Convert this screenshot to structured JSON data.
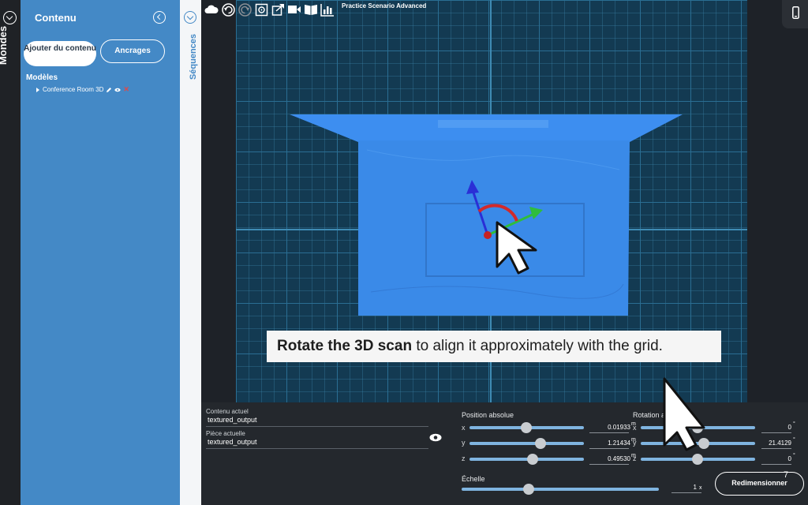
{
  "rail": {
    "title": "Mondes"
  },
  "content_panel": {
    "title": "Contenu",
    "add_button": "Ajouter du contenu",
    "anchors_button": "Ancrages",
    "models_heading": "Modèles",
    "model_item": "Conference Room 3D"
  },
  "sequences": {
    "label": "Séquences"
  },
  "viewport": {
    "title": "Practice Scenario Advanced",
    "toolbar_icons": [
      "cloud-icon",
      "undo-icon",
      "redo-icon",
      "center-view-icon",
      "share-icon",
      "video-icon",
      "book-icon",
      "chart-icon"
    ],
    "caption_bold": "Rotate the 3D scan",
    "caption_rest": " to align it approximately with the grid.",
    "accent": "#4489c6"
  },
  "properties": {
    "current_content_label": "Contenu actuel",
    "current_content_value": "textured_output",
    "current_part_label": "Pièce actuelle",
    "current_part_value": "textured_output",
    "position": {
      "title": "Position absolue",
      "unit": "m",
      "x": {
        "axis": "x",
        "value": "0.01933",
        "level": 0.42
      },
      "y": {
        "axis": "y",
        "value": "1.21434",
        "level": 0.55
      },
      "z": {
        "axis": "z",
        "value": "0.49530",
        "level": 0.45
      }
    },
    "rotation": {
      "title": "Rotation absolue",
      "unit": "°",
      "x": {
        "axis": "x",
        "value": "0",
        "level": 0.5
      },
      "y": {
        "axis": "y",
        "value": "21.4129",
        "level": 0.56
      },
      "z": {
        "axis": "z",
        "value": "0",
        "level": 0.5
      }
    },
    "scale": {
      "title": "Échelle",
      "value": "1",
      "unit": "x",
      "level": 0.33
    },
    "resize_button": "Redimensionner",
    "step_number": "7"
  }
}
